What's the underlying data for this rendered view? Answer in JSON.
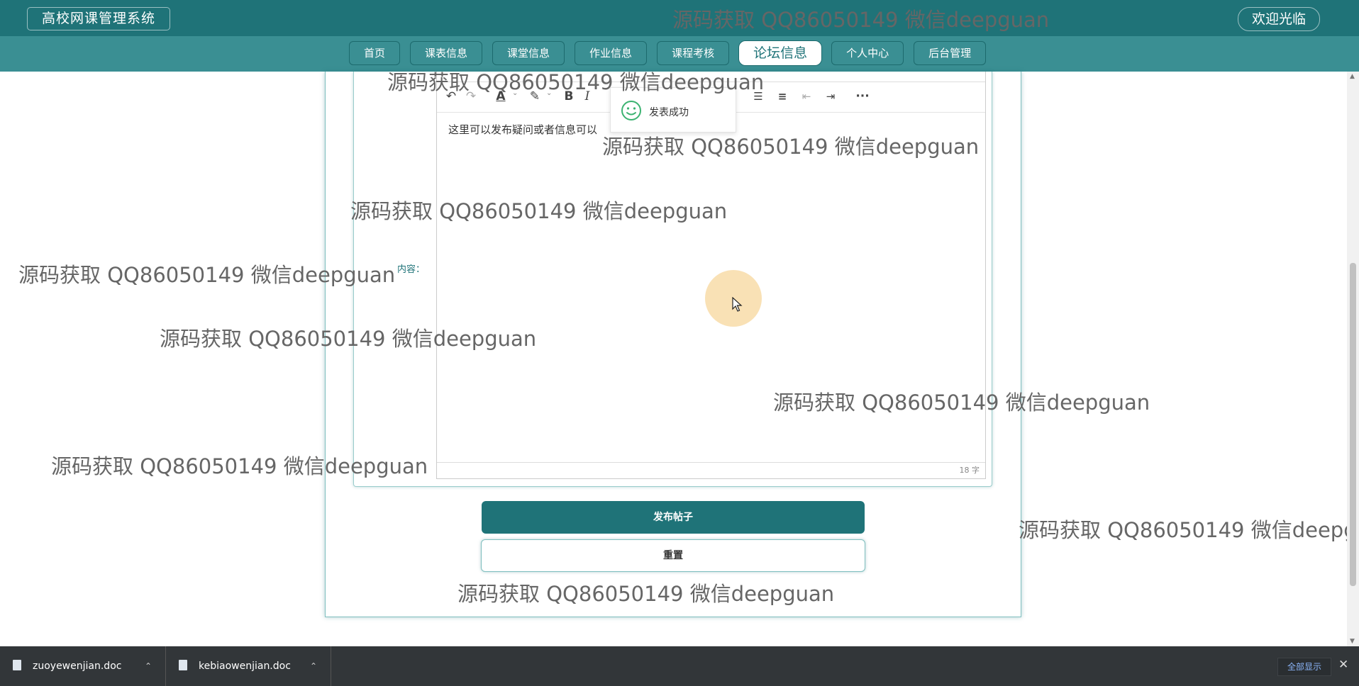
{
  "header": {
    "brand": "高校网课管理系统",
    "welcome": "欢迎光临"
  },
  "nav": {
    "items": [
      "首页",
      "课表信息",
      "课堂信息",
      "作业信息",
      "课程考核",
      "论坛信息",
      "个人中心",
      "后台管理"
    ],
    "active": "论坛信息"
  },
  "form": {
    "content_label": "内容：",
    "editor_text": "这里可以发布疑问或者信息可以",
    "word_count": "18 字",
    "submit_label": "发布帖子",
    "reset_label": "重置"
  },
  "toast": {
    "message": "发表成功"
  },
  "watermark": "源码获取 QQ86050149 微信deepguan",
  "downloads": {
    "items": [
      {
        "name": "zuoyewenjian.doc"
      },
      {
        "name": "kebiaowenjian.doc"
      }
    ],
    "show_all": "全部显示"
  },
  "icons": {
    "toolbar": [
      "undo-icon",
      "redo-icon",
      "font-color-icon",
      "highlight-icon",
      "bold-icon",
      "italic-icon",
      "align-right-icon",
      "justify-icon",
      "outdent-icon",
      "indent-icon",
      "more-icon"
    ]
  },
  "colors": {
    "primary": "#1f7378",
    "nav_bg": "#3a8f93",
    "download_bar": "#323639"
  }
}
